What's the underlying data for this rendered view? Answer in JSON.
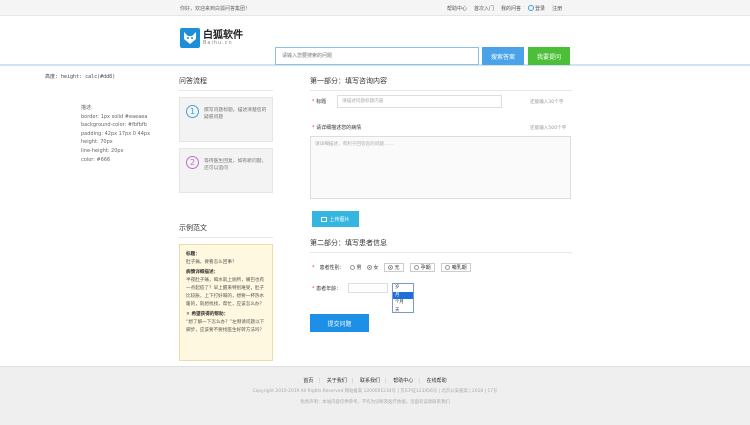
{
  "topbar": {
    "welcome": "你好，欢迎来到白狐问答集团！",
    "links": [
      "帮助中心",
      "首次入门",
      "我的问答",
      "登录",
      "注册"
    ]
  },
  "header": {
    "logo_cn": "白狐软件",
    "logo_en": "Baihu.cn",
    "search_placeholder": "请输入您要搜索的问题",
    "search_button": "搜索答案",
    "ask_button": "我要提问"
  },
  "notes": {
    "height_note": "高度: height: calc(#dd8)",
    "css_lines": [
      "描述:",
      "border: 1px solid #eaeaea",
      "background-color: #fbfbfb",
      "padding: 42px 17px 0 44px",
      "height: 70px",
      "line-height: 20px",
      "color: #666"
    ]
  },
  "sidebar": {
    "process_title": "问答流程",
    "steps": [
      {
        "num": "1",
        "text": "撰写问题标题，描述清楚您的疑惑问题"
      },
      {
        "num": "2",
        "text": "等待医生回复，如有新问题，还可以追问"
      }
    ],
    "sample_title": "示例范文",
    "sample": {
      "title_label": "标题：",
      "title_text": "肚子痛，要看怎么回事？",
      "desc_label": "病情详细描述：",
      "desc_text": "半夜肚子痛，喝水就上厕所，嘴巴也有一点起痘了？早上醒来特别难受，肚子比较胀，上下打好嗝的，想要一杯热水暖的，就想找找，帮忙，应该怎么办？",
      "help_label": "✕ 希望获得的帮助：",
      "help_text": "“想了解一下怎么办？”左侧请问题以下脚步，应该要不要找医生好转方法吗？"
    }
  },
  "form": {
    "part1_title": "第一部分：填写咨询内容",
    "title_label": "标题",
    "title_placeholder": "请描述问题标题内容",
    "title_hint": "还能输入30个字",
    "detail_label": "请详细描述您的病情",
    "detail_hint": "还能输入500个字",
    "detail_placeholder": "请详细描述，有利于回答您的问题……",
    "upload_button": "上传图片",
    "part2_title": "第二部分：填写患者信息",
    "gender_label": "患者性别：",
    "gender_options": [
      "男",
      "女"
    ],
    "status_options": [
      "无",
      "孕期",
      "哺乳期"
    ],
    "age_label": "患者年龄：",
    "age_options": [
      "岁",
      "月",
      "个月",
      "天"
    ],
    "submit_button": "提交问题"
  },
  "footer": {
    "nav": [
      "首页",
      "关于我们",
      "联系我们",
      "帮助中心",
      "在线帮助"
    ],
    "copyright": "Copyright 2010-2019 All Rights Reserved 网站备案 1200001234号 | 京ICP证123456号 | 北京公安备案 | 2018 | 17号",
    "disclaimer": "免责声明：本站内容仅供参考，不作为诊断及医疗依据。页面有误请联系我们"
  }
}
